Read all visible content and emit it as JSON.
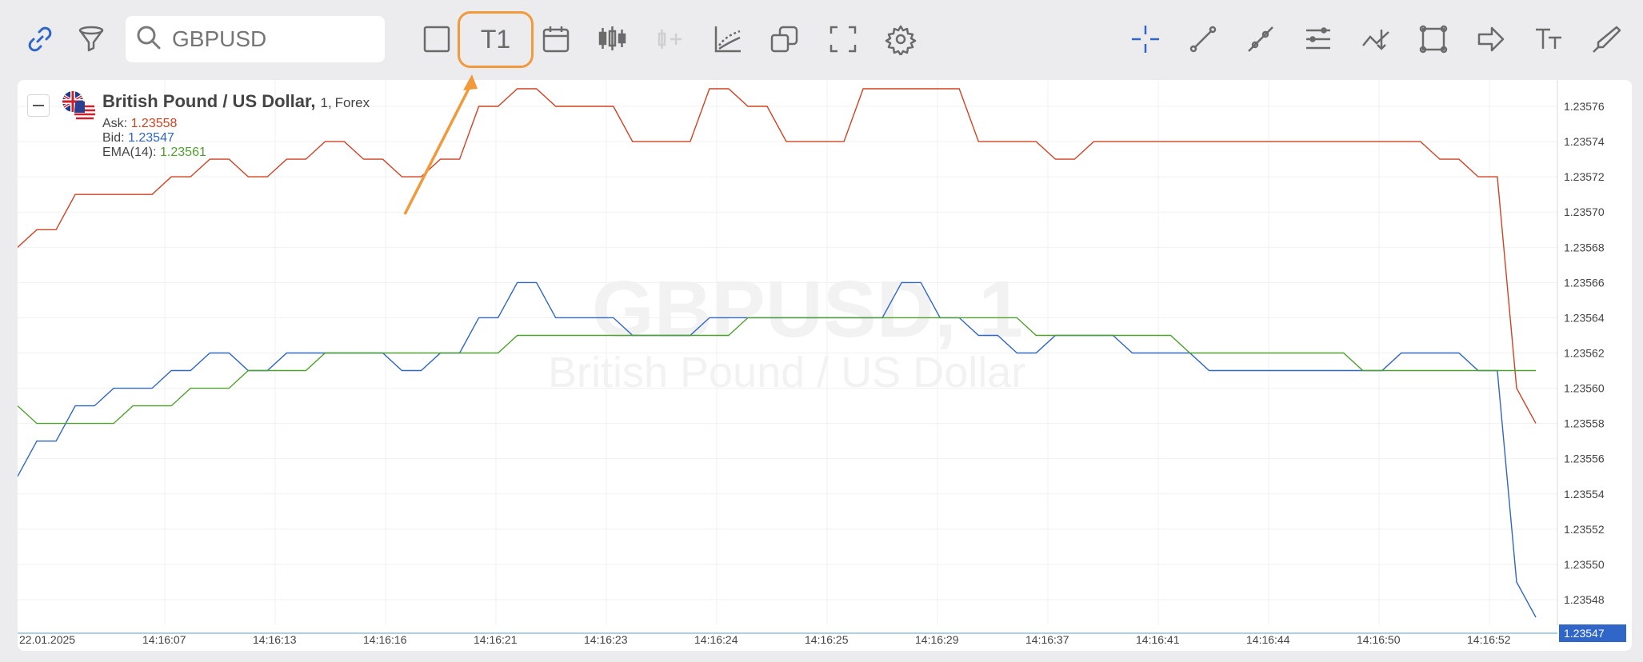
{
  "toolbar": {
    "search_placeholder": "GBPUSD",
    "timeframe_label": "T1",
    "icons_left": [
      "link-icon",
      "filter-icon",
      "search-icon",
      "square-icon",
      "timeframe-T1",
      "calendar-icon",
      "candles-icon",
      "add-indicator-icon",
      "indicators-icon",
      "compare-icon",
      "fullscreen-icon",
      "settings-icon"
    ],
    "icons_right": [
      "crosshair-icon",
      "trend-line-icon",
      "ray-icon",
      "parallel-lines-icon",
      "pitchfork-icon",
      "rectangle-icon",
      "arrow-icon",
      "text-icon",
      "brush-icon"
    ]
  },
  "legend": {
    "instrument": "British Pound / US Dollar,",
    "timeframe": "1,",
    "market": "Forex",
    "ask_label": "Ask:",
    "ask_value": "1.23558",
    "bid_label": "Bid:",
    "bid_value": "1.23547",
    "ema_label": "EMA(14):",
    "ema_value": "1.23561"
  },
  "watermark": {
    "symbol": "GBPUSD, 1",
    "name": "British Pound / US Dollar"
  },
  "colors": {
    "ask": "#d04222",
    "bid": "#2f66c8",
    "ema": "#4fa12e",
    "accent": "#2f66c8",
    "highlight": "#f09a3c"
  },
  "chart_data": {
    "type": "line",
    "title": "British Pound / US Dollar",
    "ylim": [
      1.23546,
      1.23578
    ],
    "y_ticks": [
      "1.23576",
      "1.23574",
      "1.23572",
      "1.23570",
      "1.23568",
      "1.23566",
      "1.23564",
      "1.23562",
      "1.23560",
      "1.23558",
      "1.23556",
      "1.23554",
      "1.23552",
      "1.23550",
      "1.23548"
    ],
    "x_labels": [
      "22.01.2025",
      "14:16:07",
      "14:16:13",
      "14:16:16",
      "14:16:21",
      "14:16:23",
      "14:16:24",
      "14:16:25",
      "14:16:29",
      "14:16:37",
      "14:16:41",
      "14:16:44",
      "14:16:50",
      "14:16:52"
    ],
    "current_price_label": "1.23547",
    "series": [
      {
        "name": "Ask",
        "values": [
          1.23568,
          1.23569,
          1.23569,
          1.23571,
          1.23571,
          1.23571,
          1.23571,
          1.23571,
          1.23572,
          1.23572,
          1.23573,
          1.23573,
          1.23572,
          1.23572,
          1.23573,
          1.23573,
          1.23574,
          1.23574,
          1.23573,
          1.23573,
          1.23572,
          1.23572,
          1.23573,
          1.23573,
          1.23576,
          1.23576,
          1.23577,
          1.23577,
          1.23576,
          1.23576,
          1.23576,
          1.23576,
          1.23574,
          1.23574,
          1.23574,
          1.23574,
          1.23577,
          1.23577,
          1.23576,
          1.23576,
          1.23574,
          1.23574,
          1.23574,
          1.23574,
          1.23577,
          1.23577,
          1.23577,
          1.23577,
          1.23577,
          1.23577,
          1.23574,
          1.23574,
          1.23574,
          1.23574,
          1.23573,
          1.23573,
          1.23574,
          1.23574,
          1.23574,
          1.23574,
          1.23574,
          1.23574,
          1.23574,
          1.23574,
          1.23574,
          1.23574,
          1.23574,
          1.23574,
          1.23574,
          1.23574,
          1.23574,
          1.23574,
          1.23574,
          1.23574,
          1.23573,
          1.23573,
          1.23572,
          1.23572,
          1.2356,
          1.23558
        ]
      },
      {
        "name": "Bid",
        "values": [
          1.23555,
          1.23557,
          1.23557,
          1.23559,
          1.23559,
          1.2356,
          1.2356,
          1.2356,
          1.23561,
          1.23561,
          1.23562,
          1.23562,
          1.23561,
          1.23561,
          1.23562,
          1.23562,
          1.23562,
          1.23562,
          1.23562,
          1.23562,
          1.23561,
          1.23561,
          1.23562,
          1.23562,
          1.23564,
          1.23564,
          1.23566,
          1.23566,
          1.23564,
          1.23564,
          1.23564,
          1.23564,
          1.23563,
          1.23563,
          1.23563,
          1.23563,
          1.23564,
          1.23564,
          1.23564,
          1.23564,
          1.23564,
          1.23564,
          1.23564,
          1.23564,
          1.23564,
          1.23564,
          1.23566,
          1.23566,
          1.23564,
          1.23564,
          1.23563,
          1.23563,
          1.23562,
          1.23562,
          1.23563,
          1.23563,
          1.23563,
          1.23563,
          1.23562,
          1.23562,
          1.23562,
          1.23562,
          1.23561,
          1.23561,
          1.23561,
          1.23561,
          1.23561,
          1.23561,
          1.23561,
          1.23561,
          1.23561,
          1.23561,
          1.23562,
          1.23562,
          1.23562,
          1.23562,
          1.23561,
          1.23561,
          1.23549,
          1.23547
        ]
      },
      {
        "name": "EMA(14)",
        "values": [
          1.23559,
          1.23558,
          1.23558,
          1.23558,
          1.23558,
          1.23558,
          1.23559,
          1.23559,
          1.23559,
          1.2356,
          1.2356,
          1.2356,
          1.23561,
          1.23561,
          1.23561,
          1.23561,
          1.23562,
          1.23562,
          1.23562,
          1.23562,
          1.23562,
          1.23562,
          1.23562,
          1.23562,
          1.23562,
          1.23562,
          1.23563,
          1.23563,
          1.23563,
          1.23563,
          1.23563,
          1.23563,
          1.23563,
          1.23563,
          1.23563,
          1.23563,
          1.23563,
          1.23563,
          1.23564,
          1.23564,
          1.23564,
          1.23564,
          1.23564,
          1.23564,
          1.23564,
          1.23564,
          1.23564,
          1.23564,
          1.23564,
          1.23564,
          1.23564,
          1.23564,
          1.23564,
          1.23563,
          1.23563,
          1.23563,
          1.23563,
          1.23563,
          1.23563,
          1.23563,
          1.23563,
          1.23562,
          1.23562,
          1.23562,
          1.23562,
          1.23562,
          1.23562,
          1.23562,
          1.23562,
          1.23562,
          1.23561,
          1.23561,
          1.23561,
          1.23561,
          1.23561,
          1.23561,
          1.23561,
          1.23561,
          1.23561,
          1.23561
        ]
      }
    ]
  }
}
